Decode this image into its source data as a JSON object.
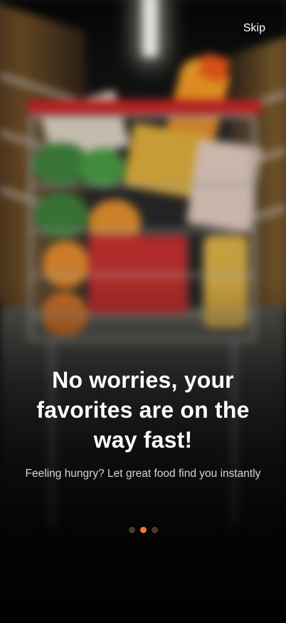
{
  "header": {
    "skip_label": "Skip"
  },
  "onboarding": {
    "title": "No worries, your favorites are on the way fast!",
    "subtitle": "Feeling hungry? Let great food find you instantly"
  },
  "pagination": {
    "total": 3,
    "active_index": 1
  },
  "colors": {
    "accent": "#f07a34",
    "inactive_dot": "#4a3a30",
    "text": "#ffffff"
  },
  "background_image": {
    "depicts": "shopping cart"
  }
}
